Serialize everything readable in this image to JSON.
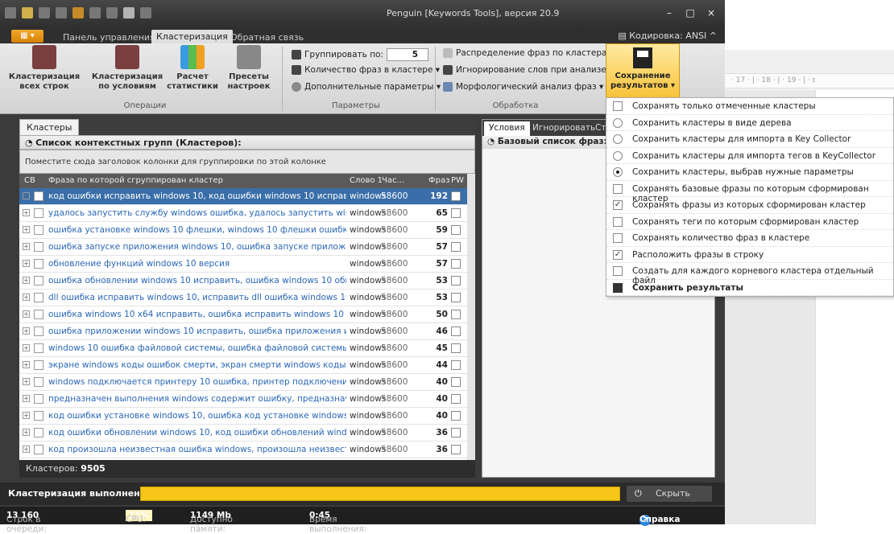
{
  "window": {
    "title": "Penguin [Keywords Tools], версия 20.9",
    "controls": [
      "–",
      "□",
      "×"
    ]
  },
  "ribbon": {
    "file": "▦ ▾",
    "tabs": [
      "Панель управления",
      "Кластеризация",
      "Обратная связь"
    ],
    "encoding": "Кодировка: ANSI",
    "buttons": [
      "Кластеризация всех строк",
      "Кластеризация по условиям",
      "Расчет статистики",
      "Пресеты настроек"
    ],
    "group_ops": "Операции",
    "group_params": "Параметры",
    "group_proc": "Обработка",
    "param_group_label": "Группировать по:",
    "param_group_value": "5",
    "param_count": "Количество фраз в кластере ▾",
    "param_extra": "Дополнительные параметры ▾",
    "proc_distribute": "Распределение фраз по кластерам ▾",
    "proc_ignore": "Игнорирование слов при анализе ▾",
    "proc_morph": "Морфологический анализ фраз ▾",
    "save_label": "Сохранение результатов ▾"
  },
  "ruler": "· 17 · | · 18 · | · 19 · | · ɪ",
  "clusters": {
    "tab": "Кластеры",
    "header": "Список контекстных групп (Кластеров):",
    "group_hint": "Поместите сюда заголовок колонки для группировки по этой колонке",
    "columns": [
      "CB",
      "Фраза по которой сгруппирован кластер",
      "Слово 1",
      "Час...",
      "Фраз",
      "PW"
    ],
    "rows": [
      {
        "phrase": "код ошибки исправить windows 10, код ошибки windows 10 исправить",
        "w": "windows",
        "n": "58600",
        "c": "192"
      },
      {
        "phrase": "удалось запустить службу windows ошибка, удалось запустить windows ошиб...",
        "w": "windows",
        "n": "58600",
        "c": "65"
      },
      {
        "phrase": "ошибка установке windows 10 флешки, windows 10 флешки ошибка установке",
        "w": "windows",
        "n": "58600",
        "c": "59"
      },
      {
        "phrase": "ошибка запуске приложения windows 10, ошибка запуске приложений windows...",
        "w": "windows",
        "n": "58600",
        "c": "57"
      },
      {
        "phrase": "обновление функций windows 10 версия",
        "w": "windows",
        "n": "58600",
        "c": "57"
      },
      {
        "phrase": "ошибка обновлении windows 10 исправить, ошибка windows 10 обновлений исп...",
        "w": "windows",
        "n": "58600",
        "c": "53"
      },
      {
        "phrase": "dll ошибка исправить windows 10, исправить dll ошибка windows 10",
        "w": "windows",
        "n": "58600",
        "c": "53"
      },
      {
        "phrase": "ошибка windows 10 x64 исправить, ошибка исправить windows 10 x64",
        "w": "windows",
        "n": "58600",
        "c": "50"
      },
      {
        "phrase": "ошибка приложении windows 10 исправить, ошибка приложения исправить win...",
        "w": "windows",
        "n": "58600",
        "c": "46"
      },
      {
        "phrase": "windows 10 ошибка файловой системы, ошибка файловой системы windows 10",
        "w": "windows",
        "n": "58600",
        "c": "45"
      },
      {
        "phrase": "экране windows коды ошибок смерти, экран смерти windows коды ошибок",
        "w": "windows",
        "n": "58600",
        "c": "44"
      },
      {
        "phrase": "windows подключается принтеру 10 ошибка, принтер подключение windows 1...",
        "w": "windows",
        "n": "58600",
        "c": "40"
      },
      {
        "phrase": "предназначен выполнения windows содержит ошибку, предназначена выполн...",
        "w": "windows",
        "n": "58600",
        "c": "40"
      },
      {
        "phrase": "код ошибки установке windows 10, ошибка код установке windows 10",
        "w": "windows",
        "n": "58600",
        "c": "40"
      },
      {
        "phrase": "код ошибки обновлении windows 10, код ошибки обновлений windows 10",
        "w": "windows",
        "n": "58600",
        "c": "36"
      },
      {
        "phrase": "код произошла неизвестная ошибка windows, произошла неизвестная ошибка ...",
        "w": "windows",
        "n": "58600",
        "c": "36"
      }
    ],
    "count_label": "Кластеров:",
    "count_value": "9505"
  },
  "right": {
    "tabs": [
      "Условия",
      "Игнорировать",
      "Ст"
    ],
    "header": "Базовый список фраз:"
  },
  "menu": [
    {
      "type": "check",
      "on": false,
      "label": "Сохранять только отмеченные кластеры"
    },
    {
      "type": "radio",
      "on": false,
      "label": "Сохранить кластеры в виде дерева"
    },
    {
      "type": "radio",
      "on": false,
      "label": "Сохранить кластеры для импорта в Key Collector"
    },
    {
      "type": "radio",
      "on": false,
      "label": "Сохранить кластеры для импорта тегов в KeyCollector"
    },
    {
      "type": "radio",
      "on": true,
      "label": "Сохранить кластеры, выбрав нужные параметры"
    },
    {
      "type": "check",
      "on": false,
      "label": "Сохранять базовые фразы по которым сформирован кластер"
    },
    {
      "type": "check",
      "on": true,
      "label": "Сохранять фразы из которых сформирован кластер"
    },
    {
      "type": "check",
      "on": false,
      "label": "Сохранять теги по которым сформирован кластер"
    },
    {
      "type": "check",
      "on": false,
      "label": "Сохранять количество фраз в кластере"
    },
    {
      "type": "check",
      "on": true,
      "label": "Расположить фразы в строку"
    },
    {
      "type": "check",
      "on": false,
      "label": "Создать для каждого корневого кластера отдельный файл"
    },
    {
      "type": "save",
      "on": false,
      "label": "Сохранить результаты"
    }
  ],
  "run": {
    "done": "Кластеризация выполнена!",
    "hide": "Скрыть"
  },
  "status": {
    "queue_label": "Строк в очереди:",
    "queue": "13 160",
    "cpu_label": "CPU:",
    "cpu": "11%",
    "mem_label": "Доступно памяти:",
    "mem": "1149 Mb",
    "time_label": "Время выполнения:",
    "time": "0:45",
    "help": "Справка"
  },
  "colors": {
    "accent": "#f5c518",
    "selected_row": "#3a6ea8",
    "link": "#2a67b5"
  }
}
